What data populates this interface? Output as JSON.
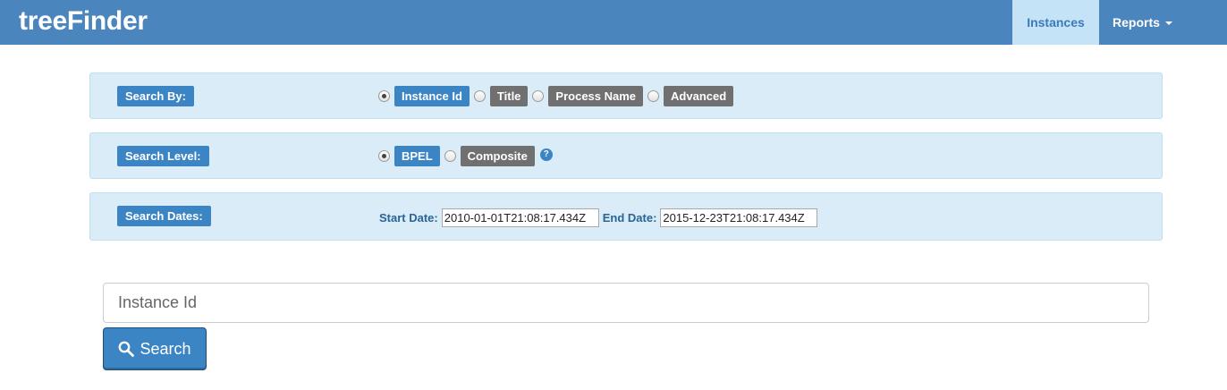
{
  "navbar": {
    "brand": "treeFinder",
    "items": [
      {
        "label": "Instances",
        "active": true
      },
      {
        "label": "Reports",
        "dropdown": true
      }
    ]
  },
  "search_by": {
    "label": "Search By:",
    "options": [
      {
        "label": "Instance Id",
        "selected": true
      },
      {
        "label": "Title",
        "selected": false
      },
      {
        "label": "Process Name",
        "selected": false
      },
      {
        "label": "Advanced",
        "selected": false
      }
    ]
  },
  "search_level": {
    "label": "Search Level:",
    "options": [
      {
        "label": "BPEL",
        "selected": true
      },
      {
        "label": "Composite",
        "selected": false
      }
    ],
    "help_icon": "question-circle-icon"
  },
  "search_dates": {
    "label": "Search Dates:",
    "start_label": "Start Date:",
    "start_value": "2010-01-01T21:08:17.434Z",
    "end_label": "End Date:",
    "end_value": "2015-12-23T21:08:17.434Z"
  },
  "search": {
    "placeholder": "Instance Id",
    "button_label": "Search",
    "button_icon": "search-icon"
  },
  "colors": {
    "navbar": "#4a86bd",
    "accent": "#3c85c4",
    "panel_bg": "#d9ecf7",
    "inactive_tag": "#707070"
  }
}
